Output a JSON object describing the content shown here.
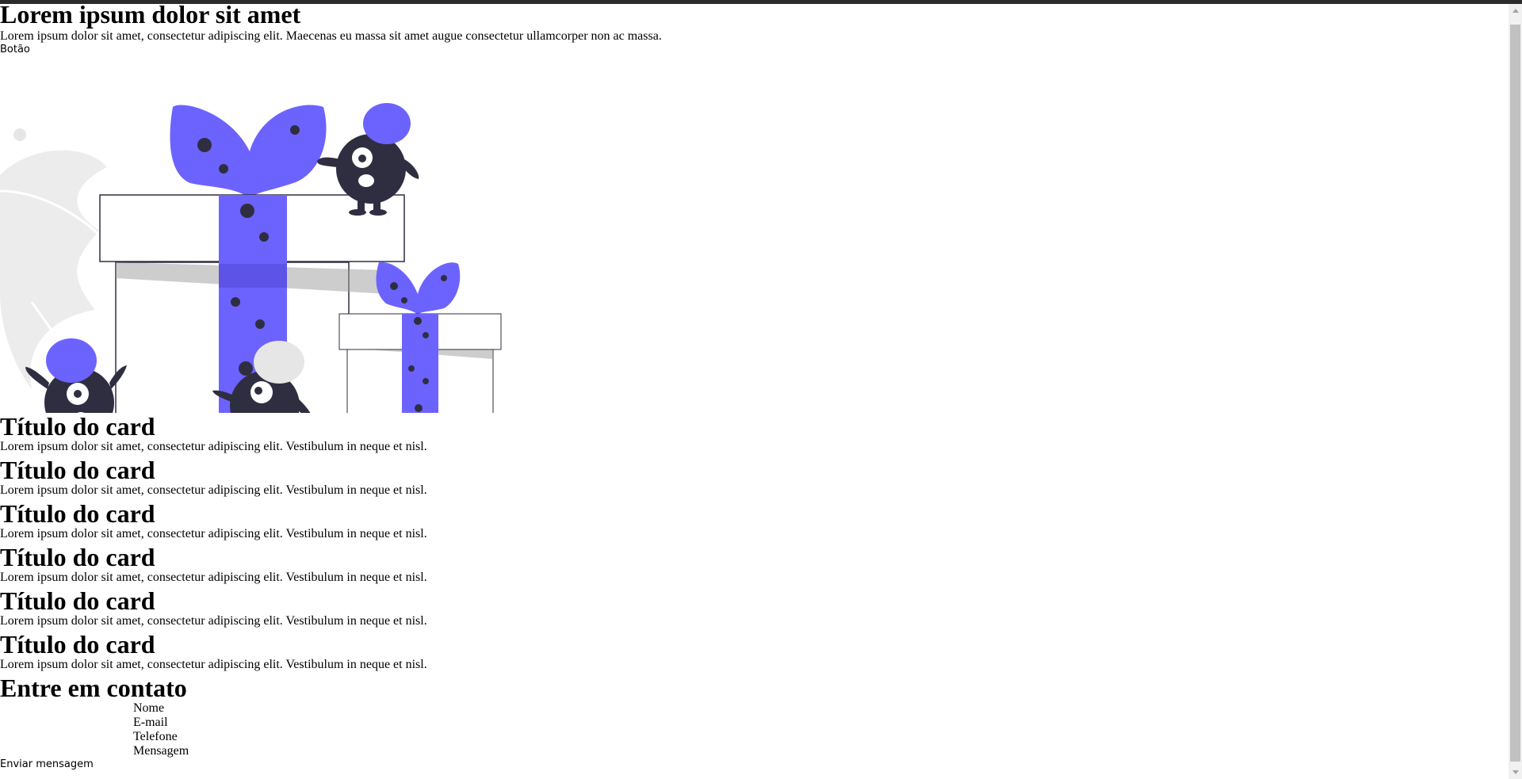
{
  "hero": {
    "title": "Lorem ipsum dolor sit amet",
    "text": "Lorem ipsum dolor sit amet, consectetur adipiscing elit. Maecenas eu massa sit amet augue consectetur ullamcorper non ac massa.",
    "button_label": "Botão"
  },
  "illustration": {
    "icon": "gift-boxes-with-monsters-illustration",
    "colors": {
      "accent": "#6c63ff",
      "dark": "#2f2e41",
      "shadow": "#cbcbcb",
      "light": "#e6e6e6"
    }
  },
  "cards": [
    {
      "title": "Título do card",
      "text": "Lorem ipsum dolor sit amet, consectetur adipiscing elit. Vestibulum in neque et nisl."
    },
    {
      "title": "Título do card",
      "text": "Lorem ipsum dolor sit amet, consectetur adipiscing elit. Vestibulum in neque et nisl."
    },
    {
      "title": "Título do card",
      "text": "Lorem ipsum dolor sit amet, consectetur adipiscing elit. Vestibulum in neque et nisl."
    },
    {
      "title": "Título do card",
      "text": "Lorem ipsum dolor sit amet, consectetur adipiscing elit. Vestibulum in neque et nisl."
    },
    {
      "title": "Título do card",
      "text": "Lorem ipsum dolor sit amet, consectetur adipiscing elit. Vestibulum in neque et nisl."
    },
    {
      "title": "Título do card",
      "text": "Lorem ipsum dolor sit amet, consectetur adipiscing elit. Vestibulum in neque et nisl."
    }
  ],
  "contact": {
    "title": "Entre em contato",
    "fields": {
      "name_label": "Nome",
      "email_label": "E-mail",
      "phone_label": "Telefone",
      "message_label": "Mensagem"
    },
    "submit_label": "Enviar mensagem"
  }
}
